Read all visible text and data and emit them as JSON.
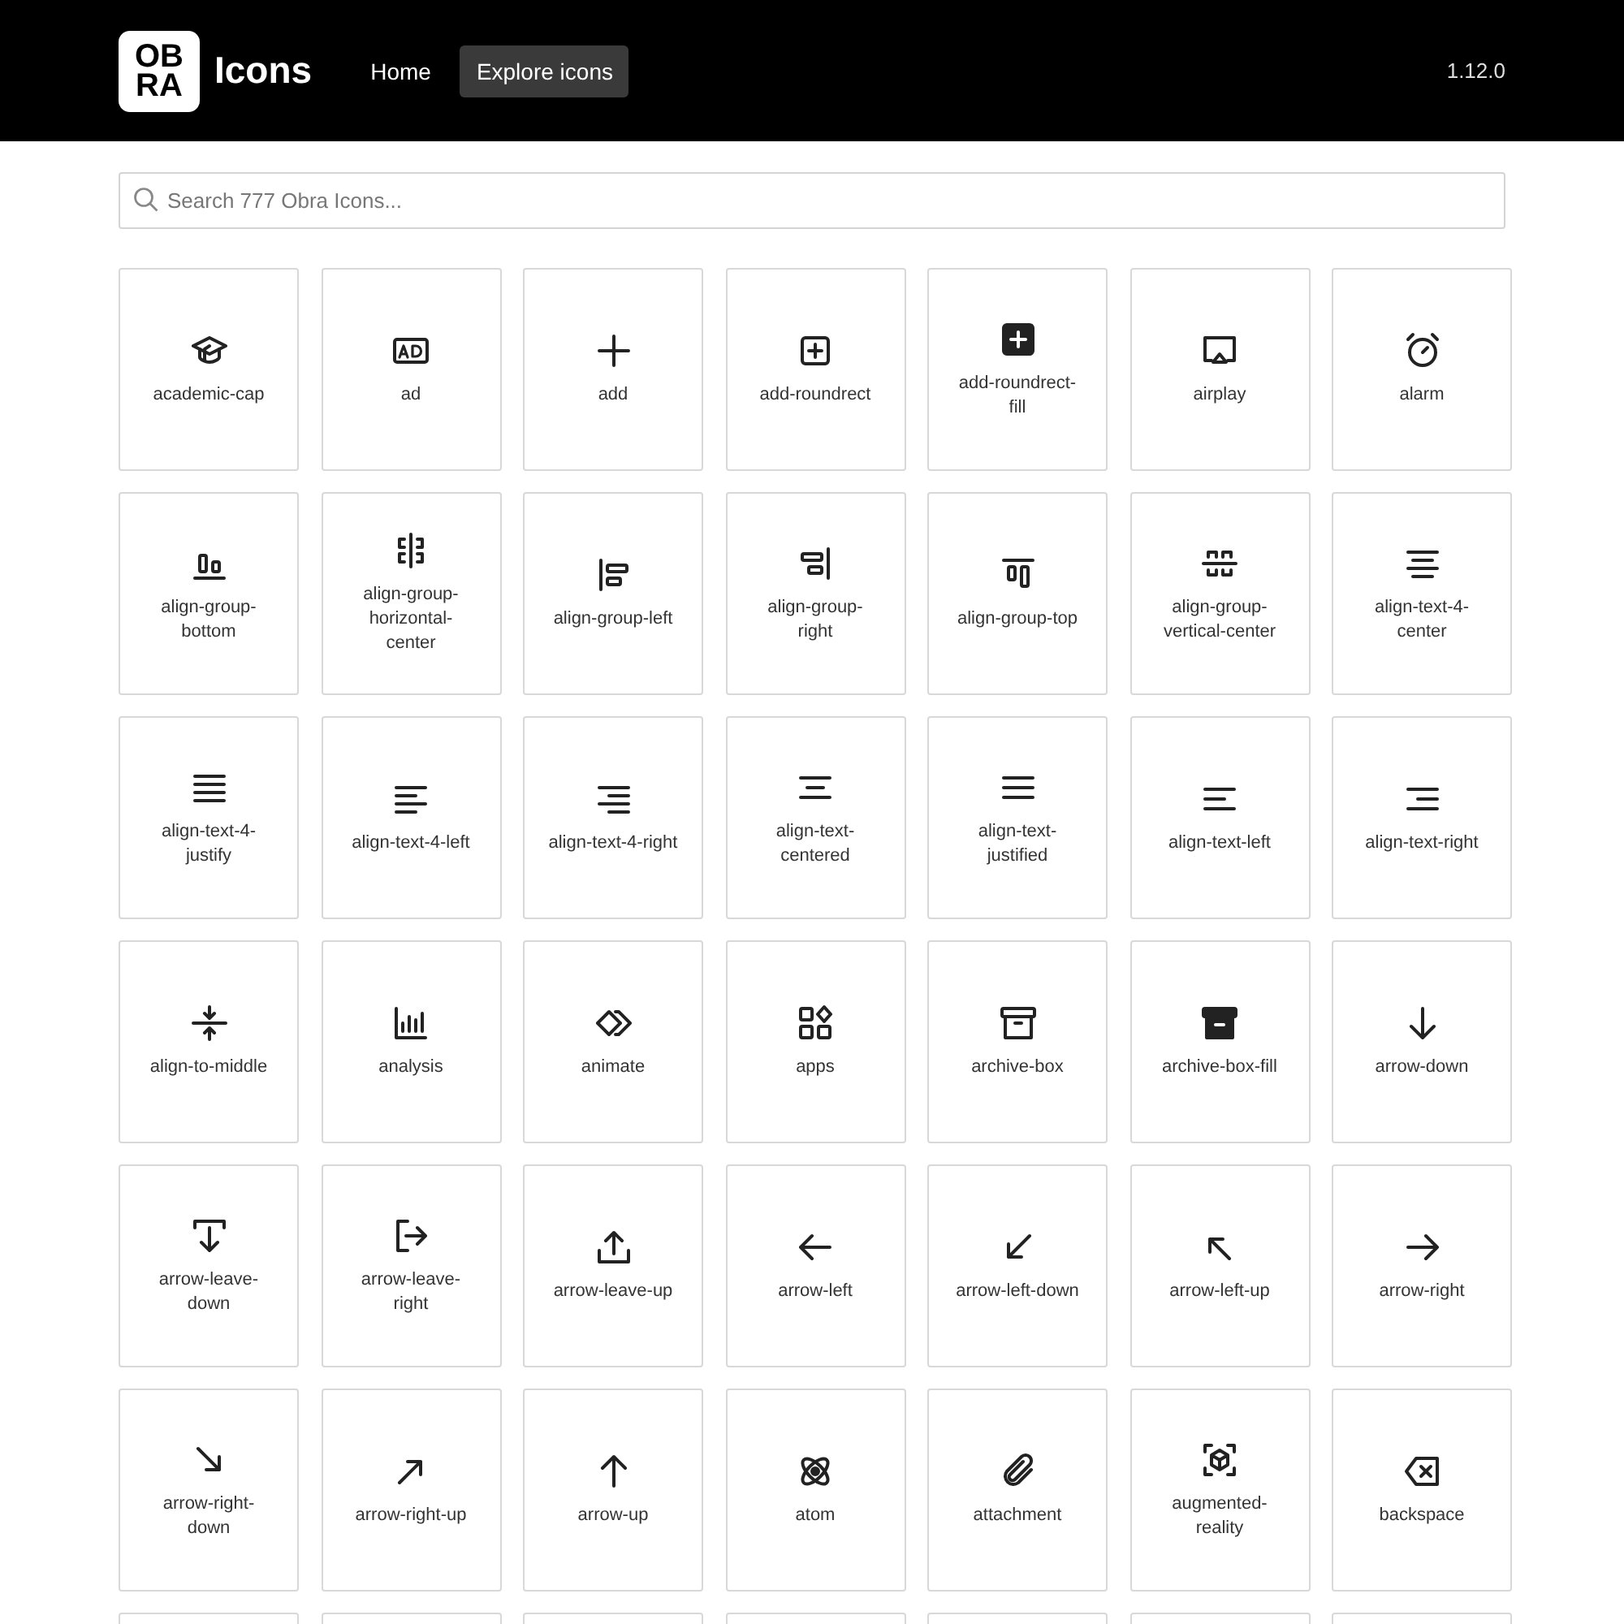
{
  "header": {
    "logo_lines": [
      "OB",
      "RA"
    ],
    "title": "Icons",
    "nav": [
      {
        "label": "Home",
        "selected": false
      },
      {
        "label": "Explore icons",
        "selected": true
      }
    ],
    "version": "1.12.0"
  },
  "search": {
    "placeholder": "Search 777 Obra Icons..."
  },
  "icons": [
    {
      "label": "academic-cap"
    },
    {
      "label": "ad"
    },
    {
      "label": "add"
    },
    {
      "label": "add-roundrect"
    },
    {
      "label": "add-roundrect-fill"
    },
    {
      "label": "airplay"
    },
    {
      "label": "alarm"
    },
    {
      "label": "align-group-bottom"
    },
    {
      "label": "align-group-horizontal-center"
    },
    {
      "label": "align-group-left"
    },
    {
      "label": "align-group-right"
    },
    {
      "label": "align-group-top"
    },
    {
      "label": "align-group-vertical-center"
    },
    {
      "label": "align-text-4-center"
    },
    {
      "label": "align-text-4-justify"
    },
    {
      "label": "align-text-4-left"
    },
    {
      "label": "align-text-4-right"
    },
    {
      "label": "align-text-centered"
    },
    {
      "label": "align-text-justified"
    },
    {
      "label": "align-text-left"
    },
    {
      "label": "align-text-right"
    },
    {
      "label": "align-to-middle"
    },
    {
      "label": "analysis"
    },
    {
      "label": "animate"
    },
    {
      "label": "apps"
    },
    {
      "label": "archive-box"
    },
    {
      "label": "archive-box-fill"
    },
    {
      "label": "arrow-down"
    },
    {
      "label": "arrow-leave-down"
    },
    {
      "label": "arrow-leave-right"
    },
    {
      "label": "arrow-leave-up"
    },
    {
      "label": "arrow-left"
    },
    {
      "label": "arrow-left-down"
    },
    {
      "label": "arrow-left-up"
    },
    {
      "label": "arrow-right"
    },
    {
      "label": "arrow-right-down"
    },
    {
      "label": "arrow-right-up"
    },
    {
      "label": "arrow-up"
    },
    {
      "label": "atom"
    },
    {
      "label": "attachment"
    },
    {
      "label": "augmented-reality"
    },
    {
      "label": "backspace"
    }
  ]
}
